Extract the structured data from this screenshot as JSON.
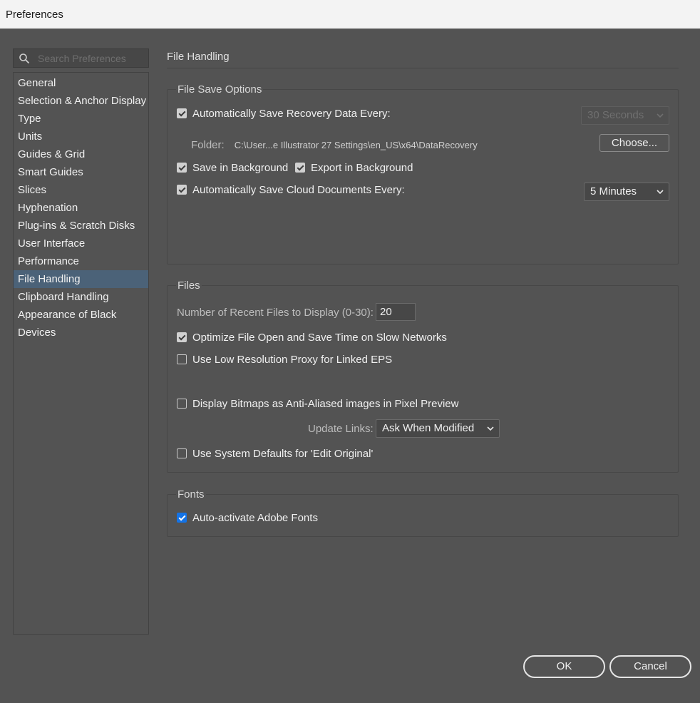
{
  "window": {
    "title": "Preferences"
  },
  "search": {
    "placeholder": "Search Preferences"
  },
  "sidebar": {
    "items": [
      "General",
      "Selection & Anchor Display",
      "Type",
      "Units",
      "Guides & Grid",
      "Smart Guides",
      "Slices",
      "Hyphenation",
      "Plug-ins & Scratch Disks",
      "User Interface",
      "Performance",
      "File Handling",
      "Clipboard Handling",
      "Appearance of Black",
      "Devices"
    ],
    "active_index": 11
  },
  "page": {
    "title": "File Handling"
  },
  "file_save_options": {
    "title": "File Save Options",
    "auto_save_recovery": {
      "label": "Automatically Save Recovery Data Every:",
      "checked": true
    },
    "recovery_interval": "30 Seconds",
    "folder_label": "Folder:",
    "folder_path": "C:\\User...e Illustrator 27 Settings\\en_US\\x64\\DataRecovery",
    "choose_button": "Choose...",
    "save_in_background": {
      "label": "Save in Background",
      "checked": true
    },
    "export_in_background": {
      "label": "Export in Background",
      "checked": true
    },
    "auto_save_cloud": {
      "label": "Automatically Save Cloud Documents Every:",
      "checked": true
    },
    "cloud_interval": "5 Minutes"
  },
  "files": {
    "title": "Files",
    "recent_files_label": "Number of Recent Files to Display (0-30):",
    "recent_files_value": "20",
    "optimize_file_open": {
      "label": "Optimize File Open and Save Time on Slow Networks",
      "checked": true
    },
    "low_res_proxy": {
      "label": "Use Low Resolution Proxy for Linked EPS",
      "checked": false
    },
    "display_bitmaps": {
      "label": "Display Bitmaps as Anti-Aliased images in Pixel Preview",
      "checked": false
    },
    "update_links_label": "Update Links:",
    "update_links_value": "Ask When Modified",
    "system_defaults": {
      "label": "Use System Defaults for 'Edit Original'",
      "checked": false
    }
  },
  "fonts": {
    "title": "Fonts",
    "auto_activate": {
      "label": "Auto-activate Adobe Fonts",
      "checked": true
    }
  },
  "footer": {
    "ok": "OK",
    "cancel": "Cancel"
  },
  "icons": {
    "search": "search-icon",
    "chevron": "chevron-down-icon",
    "checkmark": "checkmark-icon"
  }
}
